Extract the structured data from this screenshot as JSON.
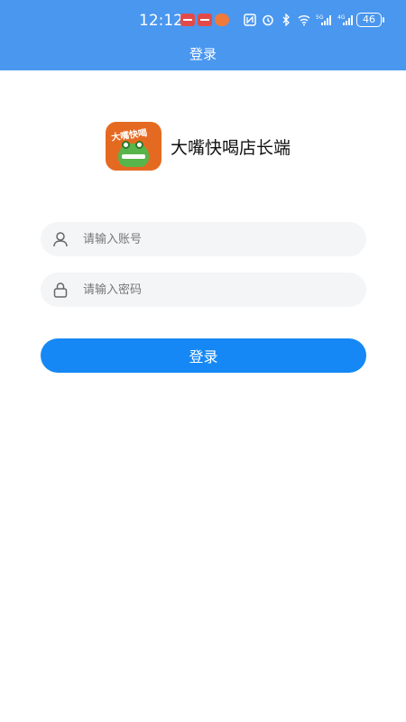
{
  "status_bar": {
    "time": "12:12",
    "icons": [
      "notification-icon",
      "notification-icon",
      "notification-icon",
      "nfc-icon",
      "alarm-icon",
      "bluetooth-icon",
      "wifi-icon",
      "signal-5g-icon",
      "signal-4g-icon"
    ],
    "battery": "46"
  },
  "header": {
    "title": "登录",
    "color": "#4a97ef"
  },
  "brand": {
    "logo_text": "大嘴快喝",
    "name": "大嘴快喝店长端"
  },
  "form": {
    "account_placeholder": "请输入账号",
    "account_value": "",
    "password_placeholder": "请输入密码",
    "password_value": "",
    "login_label": "登录",
    "button_color": "#1588f5"
  }
}
